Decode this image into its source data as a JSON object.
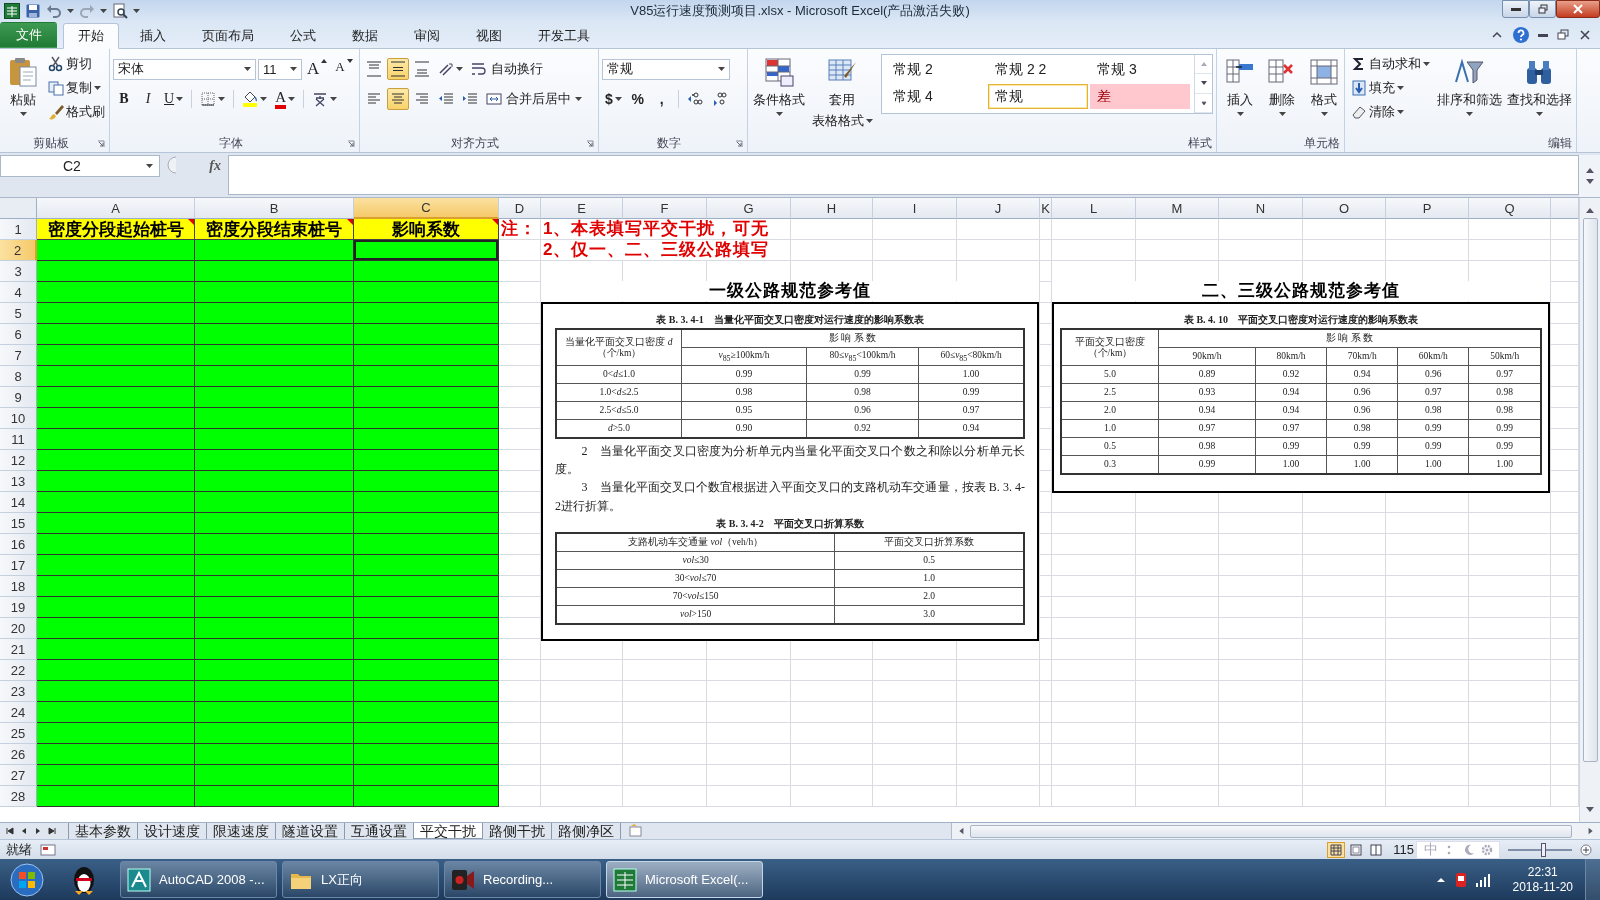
{
  "window": {
    "title": "V85运行速度预测项目.xlsx - Microsoft Excel(产品激活失败)"
  },
  "ribbon_tabs": [
    {
      "label": "文件",
      "kind": "file",
      "selected": false
    },
    {
      "label": "开始",
      "kind": "tab",
      "selected": true
    },
    {
      "label": "插入",
      "kind": "tab",
      "selected": false
    },
    {
      "label": "页面布局",
      "kind": "tab",
      "selected": false
    },
    {
      "label": "公式",
      "kind": "tab",
      "selected": false
    },
    {
      "label": "数据",
      "kind": "tab",
      "selected": false
    },
    {
      "label": "审阅",
      "kind": "tab",
      "selected": false
    },
    {
      "label": "视图",
      "kind": "tab",
      "selected": false
    },
    {
      "label": "开发工具",
      "kind": "tab",
      "selected": false
    }
  ],
  "clipboard": {
    "paste": "粘贴",
    "cut": "剪切",
    "copy": "复制",
    "format_painter": "格式刷",
    "label": "剪贴板"
  },
  "font": {
    "name": "宋体",
    "size": "11",
    "grow": "A",
    "shrink": "A",
    "bold": "B",
    "italic": "I",
    "underline": "U",
    "color_button": "A",
    "label": "字体"
  },
  "alignment": {
    "vertical": [
      {
        "selected": false
      },
      {
        "selected": true
      },
      {
        "selected": false
      }
    ],
    "horizontal": [
      {
        "selected": false
      },
      {
        "selected": true
      },
      {
        "selected": false
      }
    ],
    "wrap": "自动换行",
    "merge": "合并后居中",
    "label": "对齐方式"
  },
  "number": {
    "format": "常规",
    "currency": "$",
    "percent": "%",
    "comma": ",",
    "label": "数字"
  },
  "styles": {
    "conditional": "条件格式",
    "table_format": [
      "套用",
      "表格格式"
    ],
    "label": "样式",
    "gallery": [
      {
        "label": "常规 2",
        "kind": "plain",
        "selected": false
      },
      {
        "label": "常规 2 2",
        "kind": "plain",
        "selected": false
      },
      {
        "label": "常规 3",
        "kind": "plain",
        "selected": false
      },
      {
        "label": "常规 4",
        "kind": "plain",
        "selected": false
      },
      {
        "label": "常规",
        "kind": "plain",
        "selected": true
      },
      {
        "label": "差",
        "kind": "bad",
        "selected": false
      }
    ]
  },
  "cells": {
    "insert": "插入",
    "delete": "删除",
    "format": "格式",
    "label": "单元格"
  },
  "editing": {
    "autosum": "自动求和",
    "fill": "填充",
    "clear": "清除",
    "sort": "排序和筛选",
    "find": "查找和选择",
    "label": "编辑"
  },
  "name_box": "C2",
  "function_label": "fx",
  "sheet": {
    "columns": [
      {
        "label": "A",
        "selected": false
      },
      {
        "label": "B",
        "selected": false
      },
      {
        "label": "C",
        "selected": true
      },
      {
        "label": "D",
        "selected": false
      },
      {
        "label": "E",
        "selected": false
      },
      {
        "label": "F",
        "selected": false
      },
      {
        "label": "G",
        "selected": false
      },
      {
        "label": "H",
        "selected": false
      },
      {
        "label": "I",
        "selected": false
      },
      {
        "label": "J",
        "selected": false
      },
      {
        "label": "K",
        "selected": false
      },
      {
        "label": "L",
        "selected": false
      },
      {
        "label": "M",
        "selected": false
      },
      {
        "label": "N",
        "selected": false
      },
      {
        "label": "O",
        "selected": false
      },
      {
        "label": "P",
        "selected": false
      },
      {
        "label": "Q",
        "selected": false
      }
    ],
    "rows": [
      {
        "label": "1",
        "kind": "header",
        "selected": false
      },
      {
        "label": "2",
        "kind": "input",
        "selected": true
      },
      {
        "label": "3",
        "kind": "input",
        "selected": false
      },
      {
        "label": "4",
        "kind": "input",
        "selected": false
      },
      {
        "label": "5",
        "kind": "input",
        "selected": false
      },
      {
        "label": "6",
        "kind": "input",
        "selected": false
      },
      {
        "label": "7",
        "kind": "input",
        "selected": false
      },
      {
        "label": "8",
        "kind": "input",
        "selected": false
      },
      {
        "label": "9",
        "kind": "input",
        "selected": false
      },
      {
        "label": "10",
        "kind": "input",
        "selected": false
      },
      {
        "label": "11",
        "kind": "input",
        "selected": false
      },
      {
        "label": "12",
        "kind": "input",
        "selected": false
      },
      {
        "label": "13",
        "kind": "input",
        "selected": false
      },
      {
        "label": "14",
        "kind": "input",
        "selected": false
      },
      {
        "label": "15",
        "kind": "input",
        "selected": false
      },
      {
        "label": "16",
        "kind": "input",
        "selected": false
      },
      {
        "label": "17",
        "kind": "input",
        "selected": false
      },
      {
        "label": "18",
        "kind": "input",
        "selected": false
      },
      {
        "label": "19",
        "kind": "input",
        "selected": false
      },
      {
        "label": "20",
        "kind": "input",
        "selected": false
      },
      {
        "label": "21",
        "kind": "input",
        "selected": false
      },
      {
        "label": "22",
        "kind": "input",
        "selected": false
      },
      {
        "label": "23",
        "kind": "input",
        "selected": false
      },
      {
        "label": "24",
        "kind": "input",
        "selected": false
      },
      {
        "label": "25",
        "kind": "input",
        "selected": false
      },
      {
        "label": "26",
        "kind": "input",
        "selected": false
      },
      {
        "label": "27",
        "kind": "input",
        "selected": false
      },
      {
        "label": "28",
        "kind": "input",
        "selected": false
      }
    ],
    "header_cells": [
      {
        "text": "密度分段起始桩号",
        "comment": true
      },
      {
        "text": "密度分段结束桩号",
        "comment": true
      },
      {
        "text": "影响系数",
        "comment": true
      }
    ],
    "note_label": "注：",
    "notes": [
      "1、本表填写平交干扰，可无",
      "2、仅一、二、三级公路填写"
    ]
  },
  "references": [
    {
      "heading": "一级公路规范参考值",
      "blocks": [
        {
          "kind": "caption",
          "text": "表 B. 3. 4-1　当量化平面交叉口密度对运行速度的影响系数表"
        },
        {
          "kind": "matrix",
          "corner": [
            "当量化平面交叉口密度 *d*",
            "（个/km）"
          ],
          "group": "影 响 系 数",
          "subheads": [
            "*v*$_{85}$≥100km/h",
            "80≤*v*$_{85}$<100km/h",
            "60≤*v*$_{85}$<80km/h"
          ],
          "rows": [
            [
              "0<*d*≤1.0",
              "0.99",
              "0.99",
              "1.00"
            ],
            [
              "1.0<*d*≤2.5",
              "0.98",
              "0.98",
              "0.99"
            ],
            [
              "2.5<*d*≤5.0",
              "0.95",
              "0.96",
              "0.97"
            ],
            [
              "*d*>5.0",
              "0.90",
              "0.92",
              "0.94"
            ]
          ]
        },
        {
          "kind": "paragraph",
          "text": "2　当量化平面交叉口密度为分析单元内当量化平面交叉口个数之和除以分析单元长度。"
        },
        {
          "kind": "paragraph",
          "text": "3　当量化平面交叉口个数宜根据进入平面交叉口的支路机动车交通量，按表 B. 3. 4-2进行折算。"
        },
        {
          "kind": "caption",
          "text": "表 B. 3. 4-2　平面交叉口折算系数"
        },
        {
          "kind": "table",
          "head": [
            "支路机动车交通量 *vol*（veh/h）",
            "平面交叉口折算系数"
          ],
          "rows": [
            [
              "*vol*≤30",
              "0.5"
            ],
            [
              "30<*vol*≤70",
              "1.0"
            ],
            [
              "70<*vol*≤150",
              "2.0"
            ],
            [
              "*vol*>150",
              "3.0"
            ]
          ]
        }
      ]
    },
    {
      "heading": "二、三级公路规范参考值",
      "blocks": [
        {
          "kind": "caption",
          "text": "表 B. 4. 10　平面交叉口密度对运行速度的影响系数表"
        },
        {
          "kind": "matrix",
          "corner": [
            "平面交叉口密度",
            "（个/km）"
          ],
          "group": "影 响 系 数",
          "subheads": [
            "90km/h",
            "80km/h",
            "70km/h",
            "60km/h",
            "50km/h"
          ],
          "rows": [
            [
              "5.0",
              "0.89",
              "0.92",
              "0.94",
              "0.96",
              "0.97"
            ],
            [
              "2.5",
              "0.93",
              "0.94",
              "0.96",
              "0.97",
              "0.98"
            ],
            [
              "2.0",
              "0.94",
              "0.94",
              "0.96",
              "0.98",
              "0.98"
            ],
            [
              "1.0",
              "0.97",
              "0.97",
              "0.98",
              "0.99",
              "0.99"
            ],
            [
              "0.5",
              "0.98",
              "0.99",
              "0.99",
              "0.99",
              "0.99"
            ],
            [
              "0.3",
              "0.99",
              "1.00",
              "1.00",
              "1.00",
              "1.00"
            ]
          ]
        }
      ]
    }
  ],
  "sheet_tabs": [
    {
      "label": "基本参数",
      "selected": false
    },
    {
      "label": "设计速度",
      "selected": false
    },
    {
      "label": "限速速度",
      "selected": false
    },
    {
      "label": "隧道设置",
      "selected": false
    },
    {
      "label": "互通设置",
      "selected": false
    },
    {
      "label": "平交干扰",
      "selected": true
    },
    {
      "label": "路侧干扰",
      "selected": false
    },
    {
      "label": "路侧净区",
      "selected": false
    }
  ],
  "status": {
    "ready": "就绪",
    "zoom": "115",
    "ime": "中",
    "zoom_slider": {
      "level": 0.55
    }
  },
  "taskbar": {
    "tasks": [
      {
        "label": "AutoCAD 2008 -...",
        "kind": "cad",
        "selected": false
      },
      {
        "label": "LX正向",
        "kind": "folder",
        "selected": false
      },
      {
        "label": "Recording...",
        "kind": "recorder",
        "selected": false
      },
      {
        "label": "Microsoft Excel(...",
        "kind": "excel",
        "selected": true
      }
    ],
    "time": "22:31",
    "date": "2018-11-20"
  }
}
